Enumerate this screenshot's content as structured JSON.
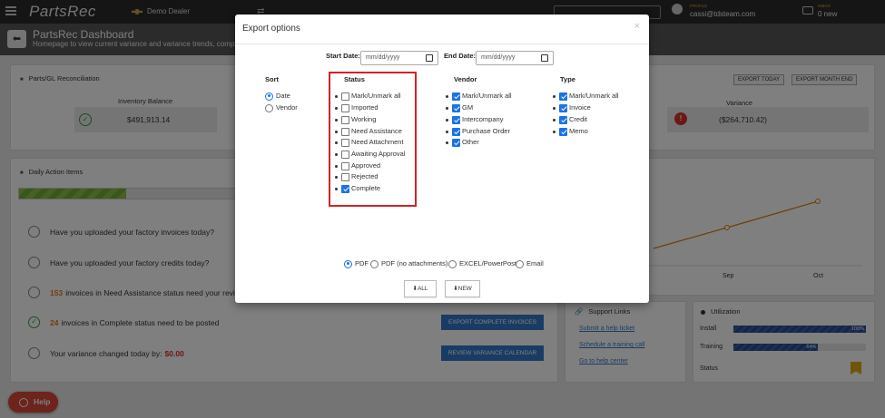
{
  "topbar": {
    "logo": "PartsRec",
    "dealer": "Demo Dealer",
    "profile_label": "PROFILE",
    "profile_value": "cassi@tdsteam.com",
    "inbox_label": "INBOX",
    "inbox_value": "0 new"
  },
  "header": {
    "title": "PartsRec Dashboard",
    "subtitle": "Homepage to view current variance and variance trends, complete daily"
  },
  "recon": {
    "title": "Parts/GL Reconciliation",
    "export_today": "EXPORT TODAY",
    "export_month_end": "EXPORT MONTH END",
    "inventory_label": "Inventory Balance",
    "inventory_value": "$491,913.14",
    "variance_label": "Variance",
    "variance_value": "($264,710.42)"
  },
  "daily": {
    "title": "Daily Action Items",
    "progress": 0.49,
    "tasks": [
      {
        "text": "Have you uploaded your factory invoices today?"
      },
      {
        "text": "Have you uploaded your factory credits today?"
      },
      {
        "num": "153",
        "text": "invoices in Need Assistance status need your review"
      },
      {
        "num": "24",
        "text": "invoices in Complete status need to be posted"
      },
      {
        "text": "Your variance changed today by:",
        "amt": "$0.00"
      }
    ],
    "btn_export": "EXPORT COMPLETE INVOICES",
    "btn_review": "REVIEW VARIANCE CALENDAR"
  },
  "trend_chart": {
    "x_labels": [
      "Sep",
      "Oct"
    ]
  },
  "support": {
    "title": "Support Links",
    "links": [
      "Submit a help ticket",
      "Schedule a training call",
      "Go to help center"
    ]
  },
  "utilization": {
    "title": "Utilization",
    "rows": [
      {
        "label": "Install",
        "pct": "100%",
        "value": 1.0
      },
      {
        "label": "Training",
        "pct": "64%",
        "value": 0.64
      },
      {
        "label": "Status"
      }
    ]
  },
  "help": {
    "label": "Help"
  },
  "modal": {
    "title": "Export options",
    "close": "×",
    "start_label": "Start Date:",
    "end_label": "End Date:",
    "date_placeholder": "mm/dd/yyyy",
    "sort": {
      "title": "Sort",
      "options": [
        "Date",
        "Vendor"
      ],
      "selected": "Date"
    },
    "status": {
      "title": "Status",
      "items": [
        {
          "label": "Mark/Unmark all",
          "checked": false
        },
        {
          "label": "Imported",
          "checked": false
        },
        {
          "label": "Working",
          "checked": false
        },
        {
          "label": "Need Assistance",
          "checked": false
        },
        {
          "label": "Need Attachment",
          "checked": false
        },
        {
          "label": "Awaiting Approval",
          "checked": false
        },
        {
          "label": "Approved",
          "checked": false
        },
        {
          "label": "Rejected",
          "checked": false
        },
        {
          "label": "Complete",
          "checked": true
        }
      ]
    },
    "vendor": {
      "title": "Vendor",
      "items": [
        {
          "label": "Mark/Unmark all",
          "checked": true
        },
        {
          "label": "GM",
          "checked": true
        },
        {
          "label": "Intercompany",
          "checked": true
        },
        {
          "label": "Purchase Order",
          "checked": true
        },
        {
          "label": "Other",
          "checked": true
        }
      ]
    },
    "type": {
      "title": "Type",
      "items": [
        {
          "label": "Mark/Unmark all",
          "checked": true
        },
        {
          "label": "Invoice",
          "checked": true
        },
        {
          "label": "Credit",
          "checked": true
        },
        {
          "label": "Memo",
          "checked": true
        }
      ]
    },
    "formats": {
      "options": [
        "PDF",
        "PDF (no attachments)",
        "EXCEL/PowerPost",
        "Email"
      ],
      "selected": "PDF"
    },
    "btn_all": "ALL",
    "btn_new": "NEW"
  },
  "colors": {
    "accent": "#1a73e8",
    "highlight_box": "#d02424",
    "button_blue": "#3478c8",
    "orange": "#e07b10"
  }
}
